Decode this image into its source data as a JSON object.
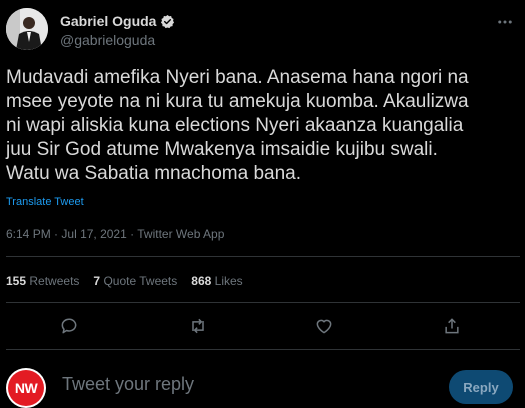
{
  "author": {
    "name": "Gabriel Oguda",
    "handle": "@gabrieloguda",
    "verified": true
  },
  "tweet": {
    "text": "Mudavadi amefika Nyeri bana. Anasema hana ngori na\nmsee yeyote na ni kura tu amekuja kuomba. Akaulizwa\nni wapi aliskia kuna elections Nyeri akaanza kuangalia\njuu Sir God atume Mwakenya imsaidie kujibu swali.\nWatu wa Sabatia mnachoma bana.",
    "translate_label": "Translate Tweet",
    "time": "6:14 PM",
    "date": "Jul 17, 2021",
    "source": "Twitter Web App"
  },
  "stats": {
    "retweets_count": "155",
    "retweets_label": "Retweets",
    "quote_count": "7",
    "quote_label": "Quote Tweets",
    "likes_count": "868",
    "likes_label": "Likes"
  },
  "reply": {
    "placeholder": "Tweet your reply",
    "button_label": "Reply",
    "avatar_text": "NW"
  },
  "colors": {
    "background": "#000000",
    "text": "#d9d9d9",
    "muted": "#6e767d",
    "link": "#1d9bf0",
    "divider": "#2f3336",
    "reply_button": "#0e4a73",
    "brand_red": "#e31b23"
  },
  "icons": [
    "verified-badge-icon",
    "more-icon",
    "reply-icon",
    "retweet-icon",
    "like-icon",
    "share-icon"
  ]
}
